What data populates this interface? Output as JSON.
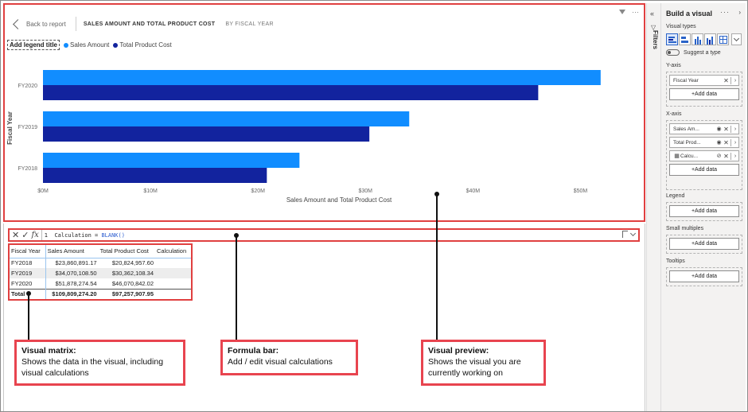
{
  "preview": {
    "back_label": "Back to report",
    "title": "SALES AMOUNT AND TOTAL PRODUCT COST",
    "subtitle": "BY FISCAL YEAR",
    "legend_title": "Add legend title",
    "legend": [
      {
        "label": "Sales Amount",
        "color": "#118dff"
      },
      {
        "label": "Total Product Cost",
        "color": "#12239e"
      }
    ]
  },
  "chart_data": {
    "type": "bar",
    "orientation": "horizontal",
    "categories": [
      "FY2020",
      "FY2019",
      "FY2018"
    ],
    "series": [
      {
        "name": "Sales Amount",
        "color": "#118dff",
        "values": [
          51878274.54,
          34070108.5,
          23860891.17
        ]
      },
      {
        "name": "Total Product Cost",
        "color": "#12239e",
        "values": [
          46070842.02,
          30362108.34,
          20824957.6
        ]
      }
    ],
    "xlabel": "Sales Amount and Total Product Cost",
    "ylabel": "Fiscal Year",
    "xlim": [
      0,
      55000000
    ],
    "xticks": [
      0,
      10000000,
      20000000,
      30000000,
      40000000,
      50000000
    ],
    "xtick_labels": [
      "$0M",
      "$10M",
      "$20M",
      "$30M",
      "$40M",
      "$50M"
    ],
    "legend_position": "top-left",
    "grid": false
  },
  "formula": {
    "line_no": "1",
    "text_before": "Calculation = ",
    "fn": "BLANK()"
  },
  "matrix": {
    "headers": [
      "Fiscal Year",
      "Sales Amount",
      "Total Product Cost",
      "Calculation"
    ],
    "rows": [
      [
        "FY2018",
        "$23,860,891.17",
        "$20,824,957.60",
        ""
      ],
      [
        "FY2019",
        "$34,070,108.50",
        "$30,362,108.34",
        ""
      ],
      [
        "FY2020",
        "$51,878,274.54",
        "$46,070,842.02",
        ""
      ]
    ],
    "total": [
      "Total",
      "$109,809,274.20",
      "$97,257,907.95",
      ""
    ]
  },
  "callouts": {
    "matrix": {
      "title": "Visual matrix:",
      "body": "Shows the data in the visual, including visual calculations"
    },
    "formula": {
      "title": "Formula bar:",
      "body": "Add / edit visual calculations"
    },
    "preview": {
      "title": "Visual preview:",
      "body": "Shows the visual you are currently working on"
    }
  },
  "filters_label": "Filters",
  "pane": {
    "title": "Build a visual",
    "visual_types_label": "Visual types",
    "suggest_label": "Suggest a type",
    "toggle_state": "Off",
    "yaxis_label": "Y-axis",
    "yaxis_fields": [
      "Fiscal Year"
    ],
    "xaxis_label": "X-axis",
    "xaxis_fields": [
      "Sales Am...",
      "Total Prod...",
      "Calcu..."
    ],
    "legend_label": "Legend",
    "small_multiples_label": "Small multiples",
    "tooltips_label": "Tooltips",
    "add_data_label": "+Add data"
  }
}
